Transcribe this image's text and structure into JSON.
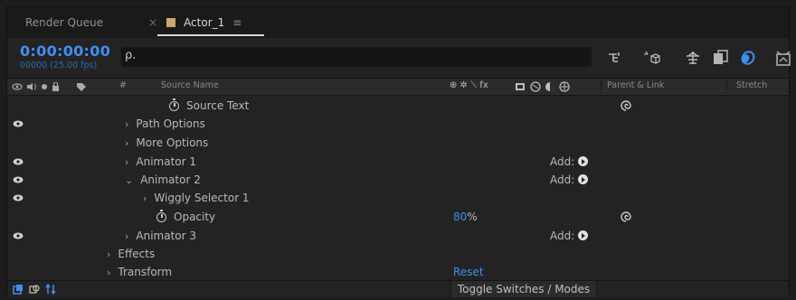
{
  "tabs": {
    "render_queue": "Render Queue",
    "active": {
      "close_glyph": "×",
      "name": "Actor_1",
      "menu_glyph": "≡",
      "swatch_color": "#c9a86a"
    }
  },
  "timecode": {
    "time": "0:00:00:00",
    "frames": "00000 (25.00 fps)"
  },
  "search": {
    "glyph": "ρ.",
    "placeholder": ""
  },
  "columns": {
    "hash": "#",
    "source_name": "Source Name",
    "parent_link": "Parent & Link",
    "stretch": "Stretch",
    "switches_glyphs": "⊕ ✲ ⟍ fx"
  },
  "rows": [
    {
      "label": "Source Text",
      "indent": "stopwatch-1",
      "eye": false,
      "pickwhip": true
    },
    {
      "label": "Path Options",
      "chevron": "›",
      "eye": true
    },
    {
      "label": "More Options",
      "chevron": "›",
      "eye": false
    },
    {
      "label": "Animator 1",
      "chevron": "›",
      "eye": true,
      "add": "Add:"
    },
    {
      "label": "Animator 2",
      "chevron": "⌄",
      "eye": true,
      "add": "Add:"
    },
    {
      "label": "Wiggly Selector 1",
      "chevron": "›",
      "eye": true
    },
    {
      "label": "Opacity",
      "value": "80",
      "unit": "%",
      "pickwhip": true
    },
    {
      "label": "Animator 3",
      "chevron": "›",
      "eye": true,
      "add": "Add:"
    },
    {
      "label": "Effects",
      "chevron": "›"
    },
    {
      "label": "Transform",
      "chevron": "›",
      "reset": "Reset"
    }
  ],
  "bottom": {
    "toggle_label": "Toggle Switches / Modes"
  },
  "colors": {
    "accent": "#3f8ff0",
    "panel": "#232323"
  }
}
